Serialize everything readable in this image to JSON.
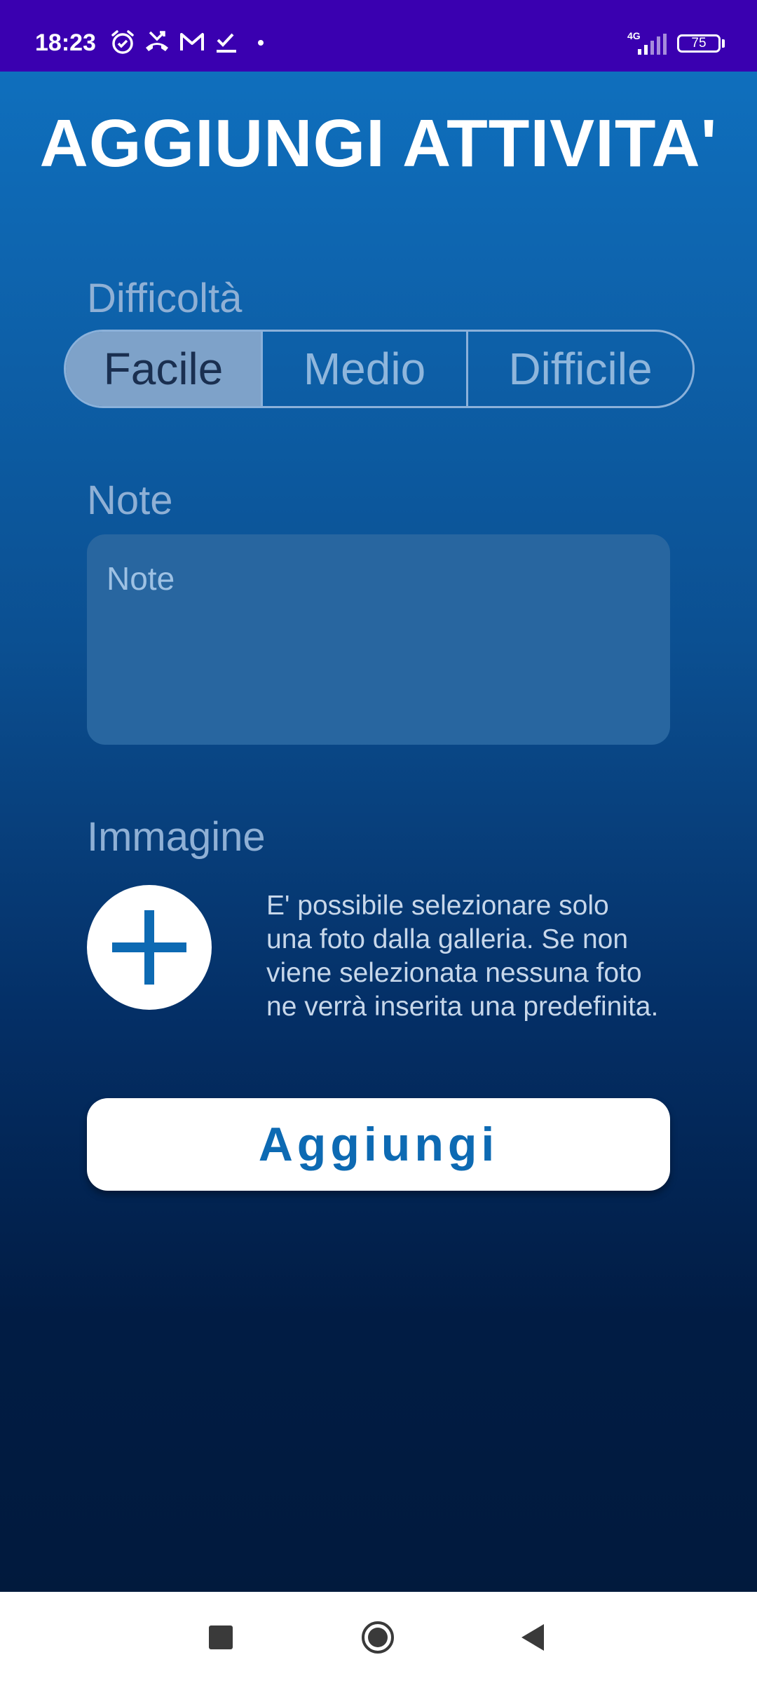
{
  "status_bar": {
    "time": "18:23",
    "network": "4G",
    "battery": "75",
    "icons": [
      "alarm-icon",
      "missed-call-icon",
      "gmail-icon",
      "tasks-icon",
      "dot-icon",
      "signal-icon",
      "battery-icon"
    ]
  },
  "header": {
    "title": "AGGIUNGI ATTIVITA'"
  },
  "difficulty": {
    "label": "Difficoltà",
    "options": [
      "Facile",
      "Medio",
      "Difficile"
    ],
    "selected": "Facile"
  },
  "note": {
    "label": "Note",
    "placeholder": "Note",
    "value": ""
  },
  "image": {
    "label": "Immagine",
    "add_icon": "plus-icon",
    "hint": "E' possibile selezionare solo una foto dalla galleria. Se non viene selezionata nessuna foto ne verrà inserita una predefinita."
  },
  "submit": {
    "label": "Aggiungi"
  },
  "colors": {
    "status_bar": "#3a00b0",
    "gradient_top": "#0f6fbd",
    "gradient_bottom": "#011a3d",
    "accent": "#0d6ab3",
    "segment_selected": "#7ea2c9"
  },
  "nav_bar": {
    "icons": [
      "recent-apps-icon",
      "home-icon",
      "back-icon"
    ]
  }
}
